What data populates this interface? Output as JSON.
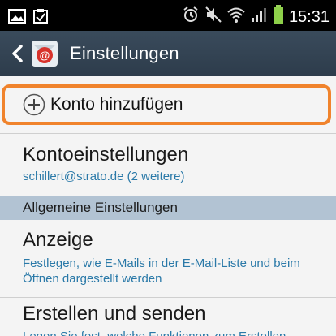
{
  "status_bar": {
    "time": "15:31",
    "left_icons": [
      "image-icon",
      "clipboard-check-icon"
    ],
    "right_icons": [
      "alarm-icon",
      "mute-icon",
      "wifi-icon",
      "signal-icon",
      "battery-icon"
    ]
  },
  "action_bar": {
    "title": "Einstellungen",
    "back_icon": "chevron-left-icon",
    "app_icon": "mail-app-icon"
  },
  "add_account": {
    "label": "Konto hinzufügen",
    "icon": "plus-circle-icon",
    "highlight_color": "#f0832c"
  },
  "account_settings": {
    "title": "Kontoeinstellungen",
    "subtitle": "schillert@strato.de (2 weitere)"
  },
  "section": {
    "title": "Allgemeine Einstellungen"
  },
  "display": {
    "title": "Anzeige",
    "subtitle": "Festlegen, wie E-Mails in der E-Mail-Liste und beim Öffnen dargestellt werden"
  },
  "compose": {
    "title": "Erstellen und senden",
    "subtitle": "Legen Sie fest, welche Funktionen zum Erstellen"
  },
  "colors": {
    "accent_link": "#2a79a8",
    "action_bar": "#34475a",
    "section_bg": "#b2c3d3"
  }
}
